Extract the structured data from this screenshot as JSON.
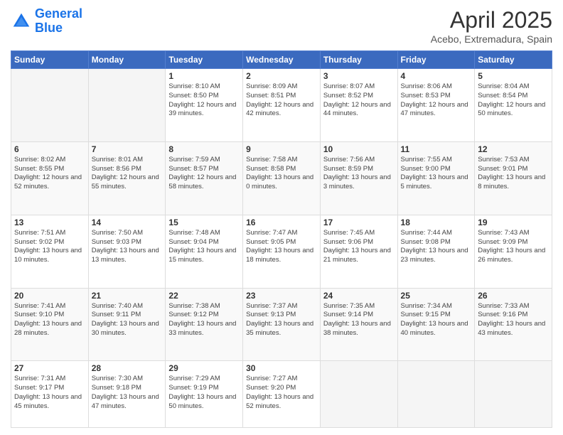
{
  "header": {
    "logo_line1": "General",
    "logo_line2": "Blue",
    "title": "April 2025",
    "subtitle": "Acebo, Extremadura, Spain"
  },
  "days_of_week": [
    "Sunday",
    "Monday",
    "Tuesday",
    "Wednesday",
    "Thursday",
    "Friday",
    "Saturday"
  ],
  "weeks": [
    [
      {
        "day": "",
        "info": ""
      },
      {
        "day": "",
        "info": ""
      },
      {
        "day": "1",
        "info": "Sunrise: 8:10 AM\nSunset: 8:50 PM\nDaylight: 12 hours and 39 minutes."
      },
      {
        "day": "2",
        "info": "Sunrise: 8:09 AM\nSunset: 8:51 PM\nDaylight: 12 hours and 42 minutes."
      },
      {
        "day": "3",
        "info": "Sunrise: 8:07 AM\nSunset: 8:52 PM\nDaylight: 12 hours and 44 minutes."
      },
      {
        "day": "4",
        "info": "Sunrise: 8:06 AM\nSunset: 8:53 PM\nDaylight: 12 hours and 47 minutes."
      },
      {
        "day": "5",
        "info": "Sunrise: 8:04 AM\nSunset: 8:54 PM\nDaylight: 12 hours and 50 minutes."
      }
    ],
    [
      {
        "day": "6",
        "info": "Sunrise: 8:02 AM\nSunset: 8:55 PM\nDaylight: 12 hours and 52 minutes."
      },
      {
        "day": "7",
        "info": "Sunrise: 8:01 AM\nSunset: 8:56 PM\nDaylight: 12 hours and 55 minutes."
      },
      {
        "day": "8",
        "info": "Sunrise: 7:59 AM\nSunset: 8:57 PM\nDaylight: 12 hours and 58 minutes."
      },
      {
        "day": "9",
        "info": "Sunrise: 7:58 AM\nSunset: 8:58 PM\nDaylight: 13 hours and 0 minutes."
      },
      {
        "day": "10",
        "info": "Sunrise: 7:56 AM\nSunset: 8:59 PM\nDaylight: 13 hours and 3 minutes."
      },
      {
        "day": "11",
        "info": "Sunrise: 7:55 AM\nSunset: 9:00 PM\nDaylight: 13 hours and 5 minutes."
      },
      {
        "day": "12",
        "info": "Sunrise: 7:53 AM\nSunset: 9:01 PM\nDaylight: 13 hours and 8 minutes."
      }
    ],
    [
      {
        "day": "13",
        "info": "Sunrise: 7:51 AM\nSunset: 9:02 PM\nDaylight: 13 hours and 10 minutes."
      },
      {
        "day": "14",
        "info": "Sunrise: 7:50 AM\nSunset: 9:03 PM\nDaylight: 13 hours and 13 minutes."
      },
      {
        "day": "15",
        "info": "Sunrise: 7:48 AM\nSunset: 9:04 PM\nDaylight: 13 hours and 15 minutes."
      },
      {
        "day": "16",
        "info": "Sunrise: 7:47 AM\nSunset: 9:05 PM\nDaylight: 13 hours and 18 minutes."
      },
      {
        "day": "17",
        "info": "Sunrise: 7:45 AM\nSunset: 9:06 PM\nDaylight: 13 hours and 21 minutes."
      },
      {
        "day": "18",
        "info": "Sunrise: 7:44 AM\nSunset: 9:08 PM\nDaylight: 13 hours and 23 minutes."
      },
      {
        "day": "19",
        "info": "Sunrise: 7:43 AM\nSunset: 9:09 PM\nDaylight: 13 hours and 26 minutes."
      }
    ],
    [
      {
        "day": "20",
        "info": "Sunrise: 7:41 AM\nSunset: 9:10 PM\nDaylight: 13 hours and 28 minutes."
      },
      {
        "day": "21",
        "info": "Sunrise: 7:40 AM\nSunset: 9:11 PM\nDaylight: 13 hours and 30 minutes."
      },
      {
        "day": "22",
        "info": "Sunrise: 7:38 AM\nSunset: 9:12 PM\nDaylight: 13 hours and 33 minutes."
      },
      {
        "day": "23",
        "info": "Sunrise: 7:37 AM\nSunset: 9:13 PM\nDaylight: 13 hours and 35 minutes."
      },
      {
        "day": "24",
        "info": "Sunrise: 7:35 AM\nSunset: 9:14 PM\nDaylight: 13 hours and 38 minutes."
      },
      {
        "day": "25",
        "info": "Sunrise: 7:34 AM\nSunset: 9:15 PM\nDaylight: 13 hours and 40 minutes."
      },
      {
        "day": "26",
        "info": "Sunrise: 7:33 AM\nSunset: 9:16 PM\nDaylight: 13 hours and 43 minutes."
      }
    ],
    [
      {
        "day": "27",
        "info": "Sunrise: 7:31 AM\nSunset: 9:17 PM\nDaylight: 13 hours and 45 minutes."
      },
      {
        "day": "28",
        "info": "Sunrise: 7:30 AM\nSunset: 9:18 PM\nDaylight: 13 hours and 47 minutes."
      },
      {
        "day": "29",
        "info": "Sunrise: 7:29 AM\nSunset: 9:19 PM\nDaylight: 13 hours and 50 minutes."
      },
      {
        "day": "30",
        "info": "Sunrise: 7:27 AM\nSunset: 9:20 PM\nDaylight: 13 hours and 52 minutes."
      },
      {
        "day": "",
        "info": ""
      },
      {
        "day": "",
        "info": ""
      },
      {
        "day": "",
        "info": ""
      }
    ]
  ]
}
